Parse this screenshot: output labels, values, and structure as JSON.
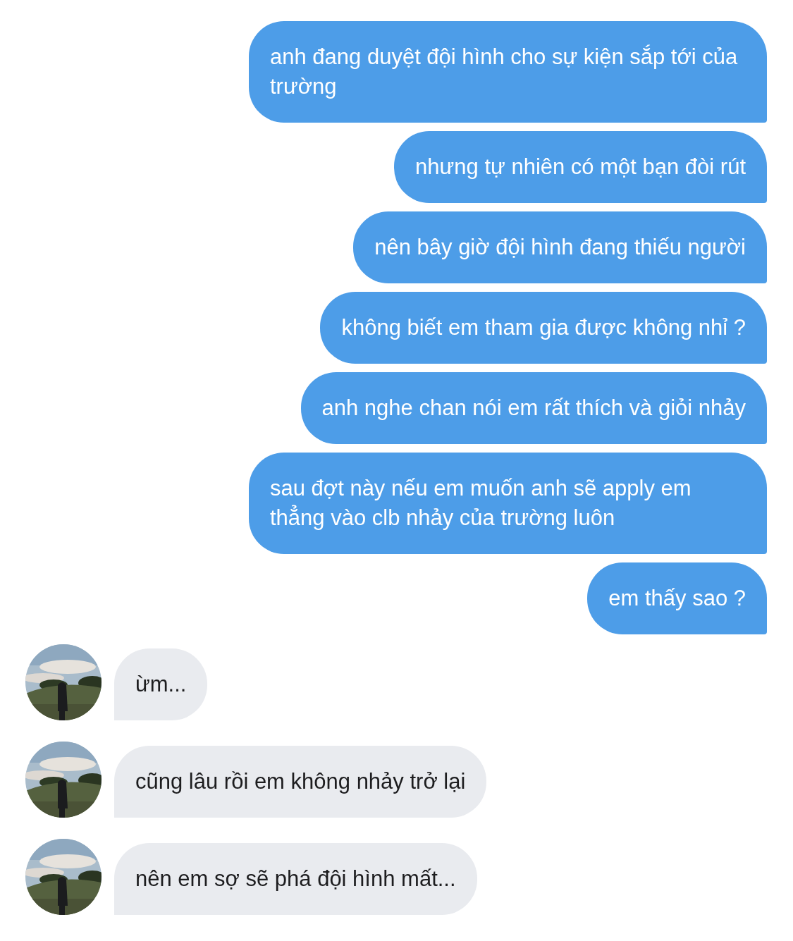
{
  "messages": [
    {
      "kind": "sent",
      "text": "anh đang duyệt đội hình cho sự kiện sắp tới của trường"
    },
    {
      "kind": "sent",
      "text": "nhưng tự nhiên có một bạn đòi rút"
    },
    {
      "kind": "sent",
      "text": "nên bây giờ đội hình đang thiếu người"
    },
    {
      "kind": "sent",
      "text": "không biết em tham gia được không nhỉ ?"
    },
    {
      "kind": "sent",
      "text": "anh nghe chan nói em rất thích và giỏi nhảy"
    },
    {
      "kind": "sent",
      "text": "sau đợt này nếu em muốn anh sẽ apply em thẳng vào clb nhảy của trường luôn"
    },
    {
      "kind": "sent",
      "text": "em thấy sao ?"
    },
    {
      "kind": "received",
      "text": "ừm..."
    },
    {
      "kind": "received",
      "text": "cũng lâu rồi em không nhảy trở lại"
    },
    {
      "kind": "received",
      "text": "nên em sợ sẽ phá đội hình mất..."
    }
  ]
}
